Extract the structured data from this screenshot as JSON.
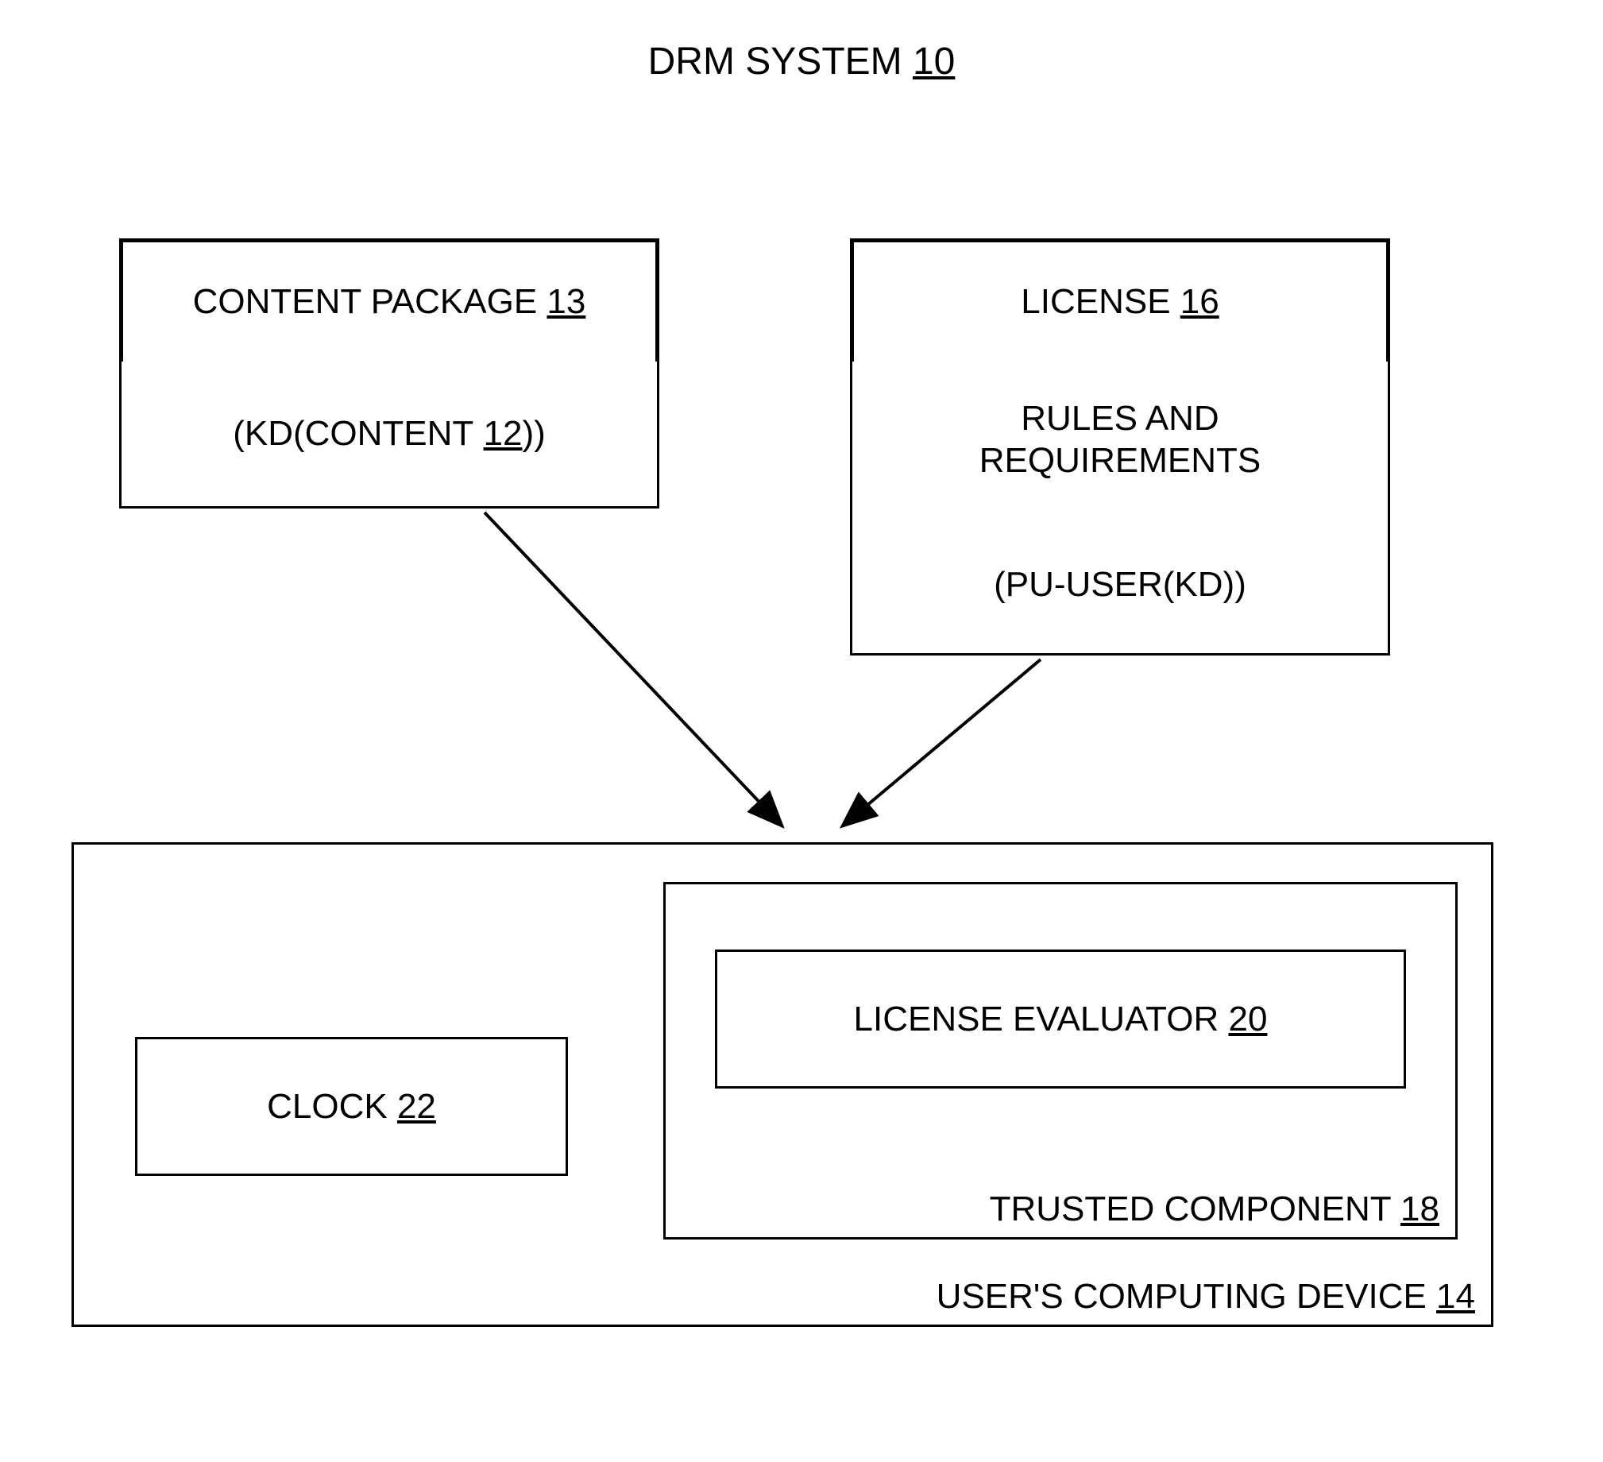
{
  "title": {
    "text": "DRM SYSTEM",
    "ref": "10"
  },
  "content_package": {
    "header": "CONTENT PACKAGE",
    "header_ref": "13",
    "kd_prefix": "(KD(CONTENT",
    "kd_ref": "12",
    "kd_suffix": "))"
  },
  "license": {
    "header": "LICENSE",
    "header_ref": "16",
    "rules_line1": "RULES AND",
    "rules_line2": "REQUIREMENTS",
    "pu_user": "(PU-USER(KD))"
  },
  "user_device": {
    "label": "USER'S COMPUTING DEVICE",
    "ref": "14"
  },
  "trusted_component": {
    "label": "TRUSTED COMPONENT",
    "ref": "18"
  },
  "license_evaluator": {
    "label": "LICENSE EVALUATOR",
    "ref": "20"
  },
  "clock": {
    "label": "CLOCK",
    "ref": "22"
  }
}
